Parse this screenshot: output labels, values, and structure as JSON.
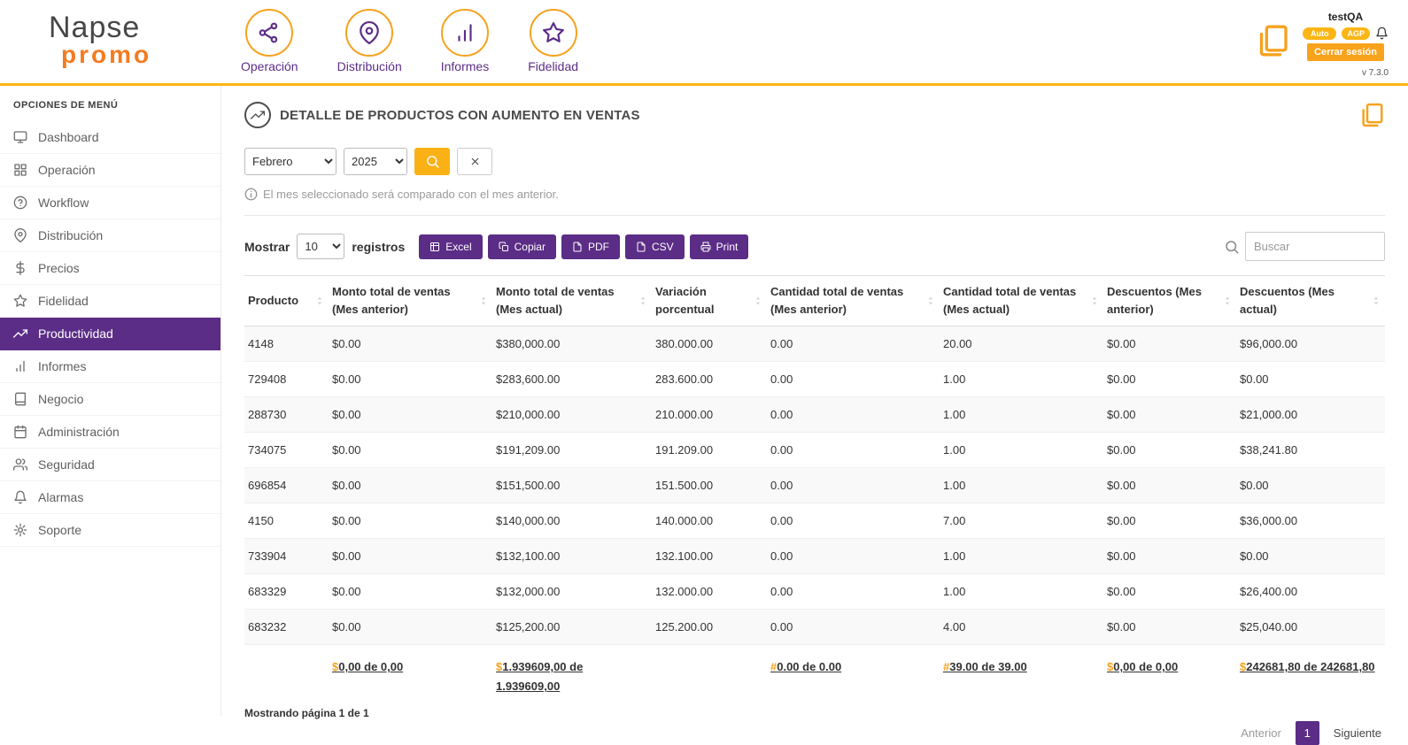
{
  "brand": {
    "name_line1": "Napse",
    "name_line2": "promo",
    "version": "v 7.3.0"
  },
  "colors": {
    "purple": "#5b2d86",
    "orange": "#f6a21e",
    "yellow": "#fcb514",
    "logo_orange": "#f47b20"
  },
  "header": {
    "nav": [
      {
        "label": "Operación",
        "icon": "share"
      },
      {
        "label": "Distribución",
        "icon": "map-pin"
      },
      {
        "label": "Informes",
        "icon": "bars"
      },
      {
        "label": "Fidelidad",
        "icon": "star"
      }
    ],
    "user": {
      "name": "testQA",
      "badges": [
        "Auto",
        "AGP"
      ],
      "logout": "Cerrar sesión"
    }
  },
  "sidebar": {
    "title": "OPCIONES DE MENÚ",
    "items": [
      {
        "label": "Dashboard",
        "icon": "monitor",
        "active": false
      },
      {
        "label": "Operación",
        "icon": "grid",
        "active": false
      },
      {
        "label": "Workflow",
        "icon": "help",
        "active": false
      },
      {
        "label": "Distribución",
        "icon": "map-pin",
        "active": false
      },
      {
        "label": "Precios",
        "icon": "dollar",
        "active": false
      },
      {
        "label": "Fidelidad",
        "icon": "star",
        "active": false
      },
      {
        "label": "Productividad",
        "icon": "trend",
        "active": true
      },
      {
        "label": "Informes",
        "icon": "bars",
        "active": false
      },
      {
        "label": "Negocio",
        "icon": "book",
        "active": false
      },
      {
        "label": "Administración",
        "icon": "calendar",
        "active": false
      },
      {
        "label": "Seguridad",
        "icon": "users",
        "active": false
      },
      {
        "label": "Alarmas",
        "icon": "bell",
        "active": false
      },
      {
        "label": "Soporte",
        "icon": "gear",
        "active": false
      }
    ]
  },
  "page": {
    "title": "DETALLE DE PRODUCTOS CON AUMENTO EN VENTAS",
    "filters": {
      "month": "Febrero",
      "year": "2025"
    },
    "info_note": "El mes seleccionado será comparado con el mes anterior.",
    "controls": {
      "show_label": "Mostrar",
      "page_size": "10",
      "registers_label": "registros",
      "export_buttons": [
        {
          "label": "Excel",
          "icon": "excel"
        },
        {
          "label": "Copiar",
          "icon": "copy"
        },
        {
          "label": "PDF",
          "icon": "file"
        },
        {
          "label": "CSV",
          "icon": "file"
        },
        {
          "label": "Print",
          "icon": "print"
        }
      ],
      "search_placeholder": "Buscar"
    },
    "table": {
      "columns": [
        "Producto",
        "Monto total de ventas (Mes anterior)",
        "Monto total de ventas (Mes actual)",
        "Variación porcentual",
        "Cantidad total de ventas (Mes anterior)",
        "Cantidad total de ventas (Mes actual)",
        "Descuentos (Mes anterior)",
        "Descuentos (Mes actual)"
      ],
      "rows": [
        [
          "4148",
          "$0.00",
          "$380,000.00",
          "380.000.00",
          "0.00",
          "20.00",
          "$0.00",
          "$96,000.00"
        ],
        [
          "729408",
          "$0.00",
          "$283,600.00",
          "283.600.00",
          "0.00",
          "1.00",
          "$0.00",
          "$0.00"
        ],
        [
          "288730",
          "$0.00",
          "$210,000.00",
          "210.000.00",
          "0.00",
          "1.00",
          "$0.00",
          "$21,000.00"
        ],
        [
          "734075",
          "$0.00",
          "$191,209.00",
          "191.209.00",
          "0.00",
          "1.00",
          "$0.00",
          "$38,241.80"
        ],
        [
          "696854",
          "$0.00",
          "$151,500.00",
          "151.500.00",
          "0.00",
          "1.00",
          "$0.00",
          "$0.00"
        ],
        [
          "4150",
          "$0.00",
          "$140,000.00",
          "140.000.00",
          "0.00",
          "7.00",
          "$0.00",
          "$36,000.00"
        ],
        [
          "733904",
          "$0.00",
          "$132,100.00",
          "132.100.00",
          "0.00",
          "1.00",
          "$0.00",
          "$0.00"
        ],
        [
          "683329",
          "$0.00",
          "$132,000.00",
          "132.000.00",
          "0.00",
          "1.00",
          "$0.00",
          "$26,400.00"
        ],
        [
          "683232",
          "$0.00",
          "$125,200.00",
          "125.200.00",
          "0.00",
          "4.00",
          "$0.00",
          "$25,040.00"
        ]
      ],
      "totals": [
        {
          "prefix": "",
          "value": ""
        },
        {
          "prefix": "$",
          "value": "0,00 de 0,00"
        },
        {
          "prefix": "$",
          "value": "1.939609,00 de 1.939609,00"
        },
        {
          "prefix": "",
          "value": ""
        },
        {
          "prefix": "#",
          "value": "0.00 de 0.00"
        },
        {
          "prefix": "#",
          "value": "39.00 de 39.00"
        },
        {
          "prefix": "$",
          "value": "0,00 de 0,00"
        },
        {
          "prefix": "$",
          "value": "242681,80 de 242681,80"
        }
      ]
    },
    "pagination": {
      "status": "Mostrando página 1 de 1",
      "prev": "Anterior",
      "current": "1",
      "next": "Siguiente"
    }
  }
}
